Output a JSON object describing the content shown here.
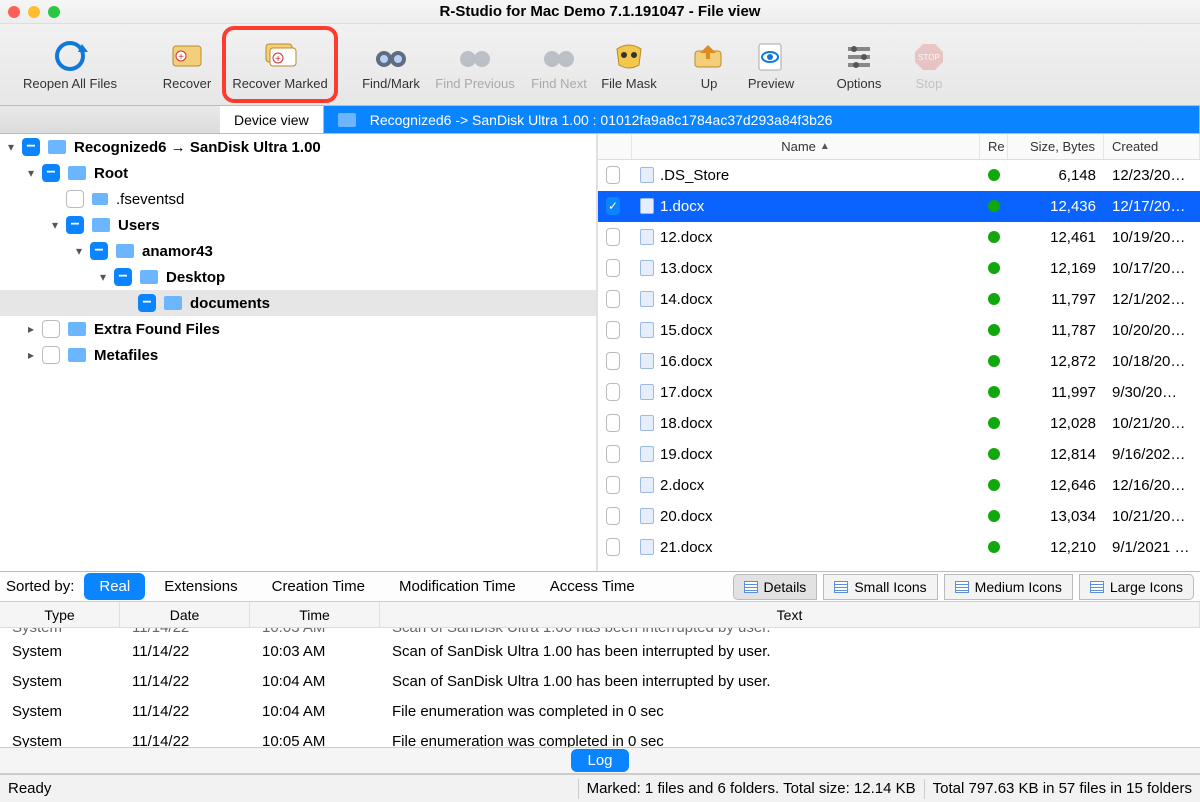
{
  "title": "R-Studio for Mac Demo 7.1.191047 - File view",
  "toolbar": {
    "reopen": "Reopen All Files",
    "recover": "Recover",
    "recover_marked": "Recover Marked",
    "find_mark": "Find/Mark",
    "find_prev": "Find Previous",
    "find_next": "Find Next",
    "file_mask": "File Mask",
    "up": "Up",
    "preview": "Preview",
    "options": "Options",
    "stop": "Stop"
  },
  "tabs": {
    "device_view": "Device view",
    "file_view": "Recognized6 -> SanDisk Ultra 1.00 : 01012fa9a8c1784ac37d293a84f3b26"
  },
  "tree": {
    "root_label": "Recognized6 → SanDisk Ultra 1.00",
    "items": {
      "root": "Root",
      "fseventsd": ".fseventsd",
      "users": "Users",
      "anamor43": "anamor43",
      "desktop": "Desktop",
      "documents": "documents",
      "extra": "Extra Found Files",
      "metafiles": "Metafiles"
    }
  },
  "files": {
    "columns": {
      "name": "Name",
      "re": "Re",
      "size": "Size, Bytes",
      "created": "Created"
    },
    "rows": [
      {
        "name": ".DS_Store",
        "size": "6,148",
        "created": "12/23/20…",
        "checked": false
      },
      {
        "name": "1.docx",
        "size": "12,436",
        "created": "12/17/20…",
        "checked": true,
        "selected": true
      },
      {
        "name": "12.docx",
        "size": "12,461",
        "created": "10/19/20…",
        "checked": false
      },
      {
        "name": "13.docx",
        "size": "12,169",
        "created": "10/17/20…",
        "checked": false
      },
      {
        "name": "14.docx",
        "size": "11,797",
        "created": "12/1/202…",
        "checked": false
      },
      {
        "name": "15.docx",
        "size": "11,787",
        "created": "10/20/20…",
        "checked": false
      },
      {
        "name": "16.docx",
        "size": "12,872",
        "created": "10/18/20…",
        "checked": false
      },
      {
        "name": "17.docx",
        "size": "11,997",
        "created": "9/30/20…",
        "checked": false
      },
      {
        "name": "18.docx",
        "size": "12,028",
        "created": "10/21/20…",
        "checked": false
      },
      {
        "name": "19.docx",
        "size": "12,814",
        "created": "9/16/202…",
        "checked": false
      },
      {
        "name": "2.docx",
        "size": "12,646",
        "created": "12/16/20…",
        "checked": false
      },
      {
        "name": "20.docx",
        "size": "13,034",
        "created": "10/21/20…",
        "checked": false
      },
      {
        "name": "21.docx",
        "size": "12,210",
        "created": "9/1/2021 …",
        "checked": false
      }
    ]
  },
  "sort": {
    "label": "Sorted by:",
    "options": [
      "Real",
      "Extensions",
      "Creation Time",
      "Modification Time",
      "Access Time"
    ],
    "views": [
      "Details",
      "Small Icons",
      "Medium Icons",
      "Large Icons"
    ]
  },
  "log": {
    "columns": {
      "type": "Type",
      "date": "Date",
      "time": "Time",
      "text": "Text"
    },
    "rows": [
      {
        "type": "System",
        "date": "11/14/22",
        "time": "10:03 AM",
        "text": "Scan of SanDisk Ultra 1.00 has been interrupted by user."
      },
      {
        "type": "System",
        "date": "11/14/22",
        "time": "10:04 AM",
        "text": "Scan of SanDisk Ultra 1.00 has been interrupted by user."
      },
      {
        "type": "System",
        "date": "11/14/22",
        "time": "10:04 AM",
        "text": "File enumeration was completed in 0 sec"
      },
      {
        "type": "System",
        "date": "11/14/22",
        "time": "10:05 AM",
        "text": "File enumeration was completed in 0 sec"
      }
    ],
    "label": "Log"
  },
  "status": {
    "ready": "Ready",
    "marked": "Marked: 1 files and 6 folders. Total size: 12.14 KB",
    "total": "Total 797.63 KB in 57 files in 15 folders"
  }
}
